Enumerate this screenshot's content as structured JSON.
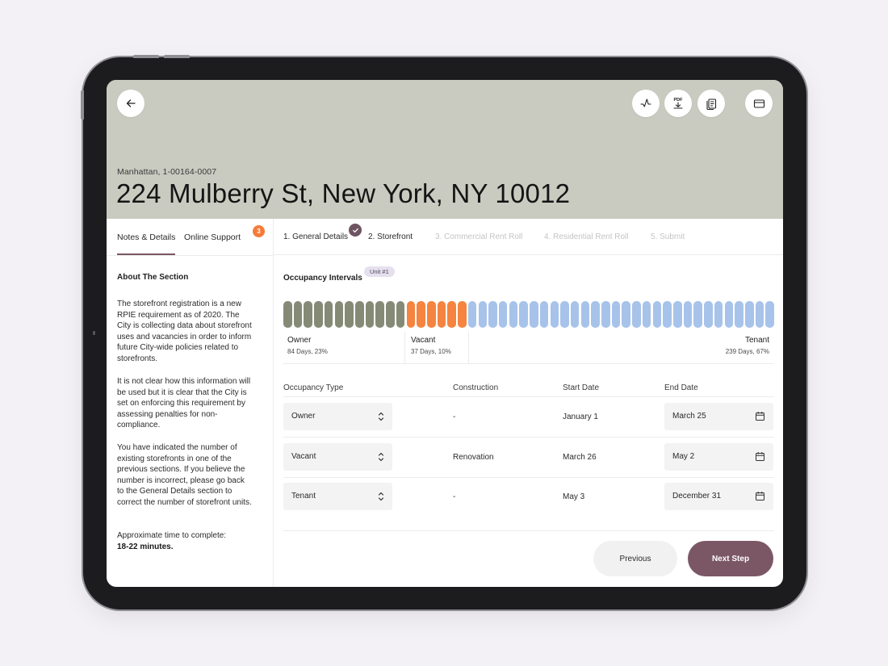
{
  "header": {
    "subtitle": "Manhattan, 1-00164-0007",
    "title": "224 Mulberry St, New York, NY 10012",
    "actions": [
      "back-arrow-icon",
      "activity-icon",
      "pdf-download-icon",
      "documents-icon",
      "card-icon"
    ],
    "pdf_label": "PDF"
  },
  "left_panel": {
    "tabs": [
      {
        "label": "Notes & Details",
        "active": true
      },
      {
        "label": "Online Support",
        "badge": "3"
      }
    ],
    "section_title": "About The Section",
    "paragraphs": [
      "The storefront registration is a new RPIE requirement as of 2020. The City is collecting data about storefront uses and vacancies in order to inform future City-wide policies related to storefronts.",
      "It is not clear how this information will be used but it is clear that the City is set on enforcing this requirement by assessing penalties for non-compliance.",
      "You have indicated the number of existing storefronts in one of the previous sections. If you believe the number is incorrect, please go back to the General Details section to correct the number of storefront units."
    ],
    "approx_label": "Approximate time to complete:",
    "approx_value": "18-22 minutes."
  },
  "steps": [
    {
      "label": "1. General Details",
      "state": "done"
    },
    {
      "label": "2. Storefront",
      "state": "current"
    },
    {
      "label": "3. Commercial Rent Roll",
      "state": "upcoming"
    },
    {
      "label": "4. Residential Rent Roll",
      "state": "upcoming"
    },
    {
      "label": "5. Submit",
      "state": "upcoming"
    }
  ],
  "occupancy": {
    "title": "Occupancy Intervals",
    "unit_pill": "Unit #1",
    "segments": [
      {
        "name": "Owner",
        "detail": "84 Days, 23%",
        "bar_count": 12,
        "color": "#858a76"
      },
      {
        "name": "Vacant",
        "detail": "37 Days, 10%",
        "bar_count": 6,
        "color": "#f4843f"
      },
      {
        "name": "Tenant",
        "detail": "239 Days, 67%",
        "bar_count": 30,
        "color": "#a7c3ea"
      }
    ]
  },
  "table": {
    "headers": [
      "Occupancy Type",
      "Construction",
      "Start Date",
      "End Date"
    ],
    "rows": [
      {
        "type": "Owner",
        "construction": "-",
        "start": "January 1",
        "end": "March 25"
      },
      {
        "type": "Vacant",
        "construction": "Renovation",
        "start": "March 26",
        "end": "May 2"
      },
      {
        "type": "Tenant",
        "construction": "-",
        "start": "May 3",
        "end": "December 31"
      }
    ]
  },
  "buttons": {
    "previous": "Previous",
    "next": "Next Step"
  },
  "colors": {
    "hero": "#c9cbc0",
    "accent": "#7b5766",
    "badge": "#f47b3a"
  }
}
